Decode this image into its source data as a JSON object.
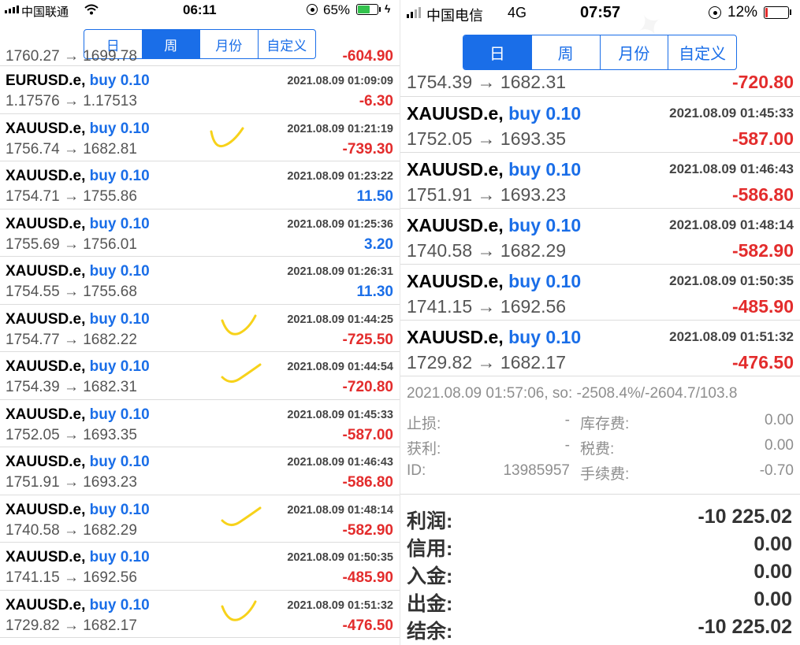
{
  "left": {
    "status": {
      "carrier": "中国联通",
      "wifi_icon": "wifi-icon",
      "time": "06:11",
      "battery_pct": "65%",
      "battery_level": 0.65,
      "battery_color": "#33c24d"
    },
    "tabs": [
      {
        "label": "日",
        "active": false
      },
      {
        "label": "周",
        "active": true
      },
      {
        "label": "月份",
        "active": false
      },
      {
        "label": "自定义",
        "active": false
      }
    ],
    "partial_row": {
      "prices": "1760.27 → 1699.78",
      "pl": "-604.90"
    },
    "deals": [
      {
        "symbol": "EURUSD.e,",
        "action": "buy 0.10",
        "datetime": "2021.08.09 01:09:09",
        "prices": "1.17576 → 1.17513",
        "pl": "-6.30",
        "sign": "neg",
        "check": false
      },
      {
        "symbol": "XAUUSD.e,",
        "action": "buy 0.10",
        "datetime": "2021.08.09 01:21:19",
        "prices": "1756.74 → 1682.81",
        "pl": "-739.30",
        "sign": "neg",
        "check": true
      },
      {
        "symbol": "XAUUSD.e,",
        "action": "buy 0.10",
        "datetime": "2021.08.09 01:23:22",
        "prices": "1754.71 → 1755.86",
        "pl": "11.50",
        "sign": "pos",
        "check": false
      },
      {
        "symbol": "XAUUSD.e,",
        "action": "buy 0.10",
        "datetime": "2021.08.09 01:25:36",
        "prices": "1755.69 → 1756.01",
        "pl": "3.20",
        "sign": "pos",
        "check": false
      },
      {
        "symbol": "XAUUSD.e,",
        "action": "buy 0.10",
        "datetime": "2021.08.09 01:26:31",
        "prices": "1754.55 → 1755.68",
        "pl": "11.30",
        "sign": "pos",
        "check": false
      },
      {
        "symbol": "XAUUSD.e,",
        "action": "buy 0.10",
        "datetime": "2021.08.09 01:44:25",
        "prices": "1754.77 → 1682.22",
        "pl": "-725.50",
        "sign": "neg",
        "check": true
      },
      {
        "symbol": "XAUUSD.e,",
        "action": "buy 0.10",
        "datetime": "2021.08.09 01:44:54",
        "prices": "1754.39 → 1682.31",
        "pl": "-720.80",
        "sign": "neg",
        "check": true
      },
      {
        "symbol": "XAUUSD.e,",
        "action": "buy 0.10",
        "datetime": "2021.08.09 01:45:33",
        "prices": "1752.05 → 1693.35",
        "pl": "-587.00",
        "sign": "neg",
        "check": false
      },
      {
        "symbol": "XAUUSD.e,",
        "action": "buy 0.10",
        "datetime": "2021.08.09 01:46:43",
        "prices": "1751.91 → 1693.23",
        "pl": "-586.80",
        "sign": "neg",
        "check": false
      },
      {
        "symbol": "XAUUSD.e,",
        "action": "buy 0.10",
        "datetime": "2021.08.09 01:48:14",
        "prices": "1740.58 → 1682.29",
        "pl": "-582.90",
        "sign": "neg",
        "check": true
      },
      {
        "symbol": "XAUUSD.e,",
        "action": "buy 0.10",
        "datetime": "2021.08.09 01:50:35",
        "prices": "1741.15 → 1692.56",
        "pl": "-485.90",
        "sign": "neg",
        "check": false
      },
      {
        "symbol": "XAUUSD.e,",
        "action": "buy 0.10",
        "datetime": "2021.08.09 01:51:32",
        "prices": "1729.82 → 1682.17",
        "pl": "-476.50",
        "sign": "neg",
        "check": true
      }
    ]
  },
  "right": {
    "status": {
      "carrier": "中国电信",
      "network": "4G",
      "time": "07:57",
      "battery_pct": "12%",
      "battery_level": 0.12,
      "battery_color": "#e32c2c"
    },
    "tabs": [
      {
        "label": "日",
        "active": true
      },
      {
        "label": "周",
        "active": false
      },
      {
        "label": "月份",
        "active": false
      },
      {
        "label": "自定义",
        "active": false
      }
    ],
    "partial_row": {
      "prices": "1754.39 → 1682.31",
      "pl": "-720.80"
    },
    "deals": [
      {
        "symbol": "XAUUSD.e,",
        "action": "buy 0.10",
        "datetime": "2021.08.09 01:45:33",
        "prices": "1752.05 → 1693.35",
        "pl": "-587.00",
        "sign": "neg"
      },
      {
        "symbol": "XAUUSD.e,",
        "action": "buy 0.10",
        "datetime": "2021.08.09 01:46:43",
        "prices": "1751.91 → 1693.23",
        "pl": "-586.80",
        "sign": "neg"
      },
      {
        "symbol": "XAUUSD.e,",
        "action": "buy 0.10",
        "datetime": "2021.08.09 01:48:14",
        "prices": "1740.58 → 1682.29",
        "pl": "-582.90",
        "sign": "neg"
      },
      {
        "symbol": "XAUUSD.e,",
        "action": "buy 0.10",
        "datetime": "2021.08.09 01:50:35",
        "prices": "1741.15 → 1692.56",
        "pl": "-485.90",
        "sign": "neg"
      },
      {
        "symbol": "XAUUSD.e,",
        "action": "buy 0.10",
        "datetime": "2021.08.09 01:51:32",
        "prices": "1729.82 → 1682.17",
        "pl": "-476.50",
        "sign": "neg"
      }
    ],
    "summary": {
      "close_line": "2021.08.09 01:57:06, so: -2508.4%/-2604.7/103.8",
      "details": [
        {
          "label": "止损:",
          "value": "-",
          "label2": "库存费:",
          "value2": "0.00"
        },
        {
          "label": "获利:",
          "value": "-",
          "label2": "税费:",
          "value2": "0.00"
        },
        {
          "label": "ID:",
          "value": "13985957",
          "label2": "手续费:",
          "value2": "-0.70"
        }
      ],
      "totals": [
        {
          "label": "利润:",
          "value": "-10 225.02"
        },
        {
          "label": "信用:",
          "value": "0.00"
        },
        {
          "label": "入金:",
          "value": "0.00"
        },
        {
          "label": "出金:",
          "value": "0.00"
        },
        {
          "label": "结余:",
          "value": "-10 225.02"
        }
      ]
    }
  }
}
